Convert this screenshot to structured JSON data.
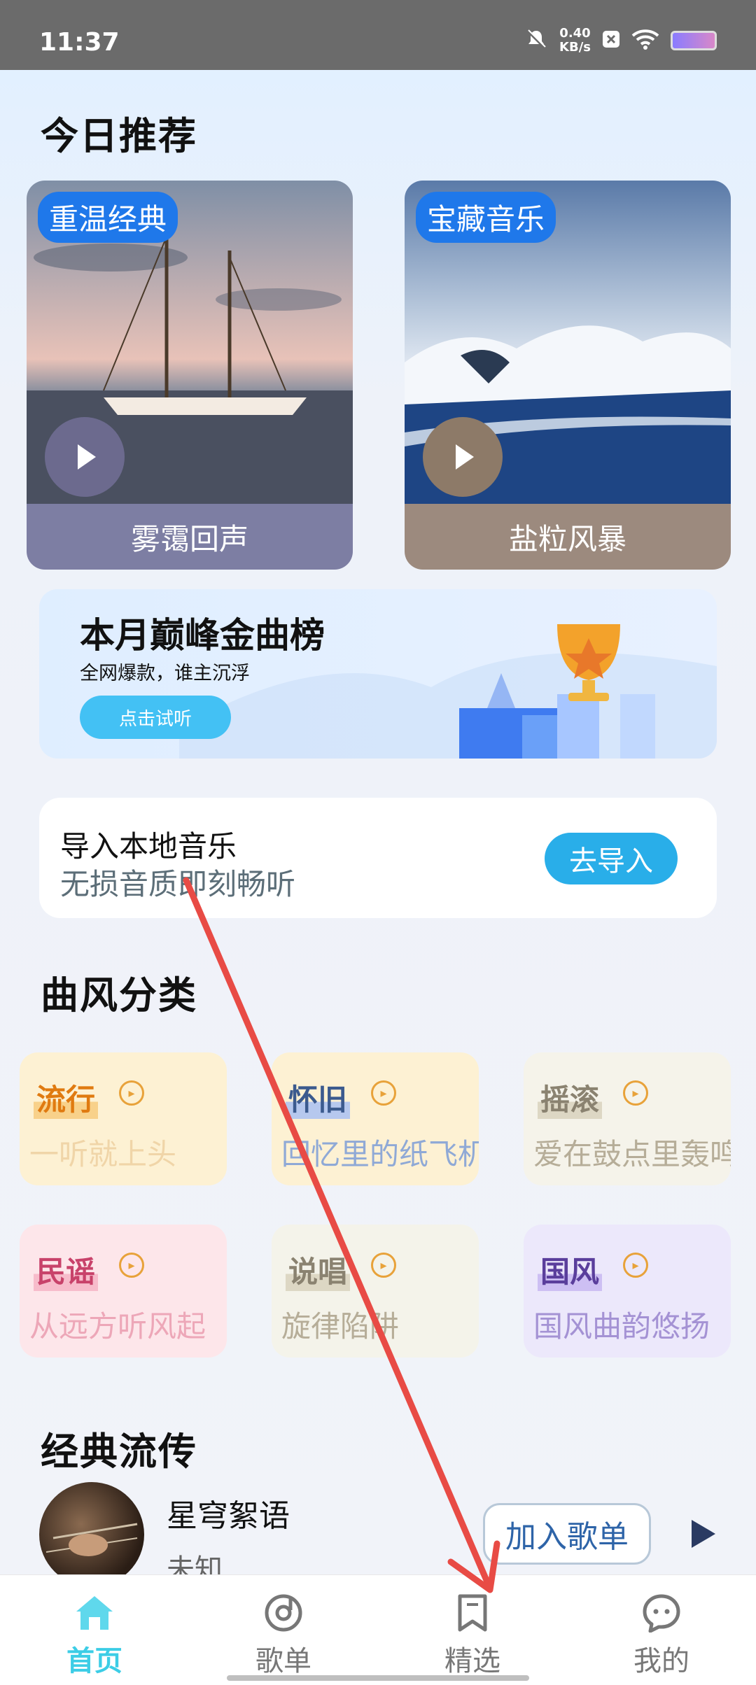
{
  "status_bar": {
    "time": "11:37",
    "speed_value": "0.40",
    "speed_unit": "KB/s"
  },
  "today": {
    "title": "今日推荐",
    "cards": [
      {
        "tag": "重温经典",
        "label": "雾霭回声",
        "label_bg": "#7d7ea3"
      },
      {
        "tag": "宝藏音乐",
        "label": "盐粒风暴",
        "label_bg": "#9c8a7e"
      }
    ]
  },
  "banner": {
    "title": "本月巅峰金曲榜",
    "subtitle": "全网爆款，谁主沉浮",
    "button": "点击试听"
  },
  "import": {
    "title": "导入本地音乐",
    "subtitle": "无损音质即刻畅听",
    "button": "去导入"
  },
  "genres": {
    "title": "曲风分类",
    "items": [
      {
        "name": "流行",
        "desc": "一听就上头",
        "bg": "#fdf1d3"
      },
      {
        "name": "怀旧",
        "desc": "回忆里的纸飞机",
        "bg": "#fdf1d3"
      },
      {
        "name": "摇滚",
        "desc": "爱在鼓点里轰鸣",
        "bg": "#f5f3ea"
      },
      {
        "name": "民谣",
        "desc": "从远方听风起",
        "bg": "#fde6ea"
      },
      {
        "name": "说唱",
        "desc": "旋律陷阱",
        "bg": "#f4f3ea"
      },
      {
        "name": "国风",
        "desc": "国风曲韵悠扬",
        "bg": "#ece8fb"
      }
    ]
  },
  "classic": {
    "title": "经典流传",
    "song": {
      "title": "星穹絮语",
      "artist": "未知",
      "add_button": "加入歌单"
    }
  },
  "tabbar": {
    "tabs": [
      {
        "label": "首页",
        "icon": "home-icon",
        "active": true
      },
      {
        "label": "歌单",
        "icon": "disc-icon",
        "active": false
      },
      {
        "label": "精选",
        "icon": "bookmark-icon",
        "active": false
      },
      {
        "label": "我的",
        "icon": "chat-face-icon",
        "active": false
      }
    ]
  }
}
